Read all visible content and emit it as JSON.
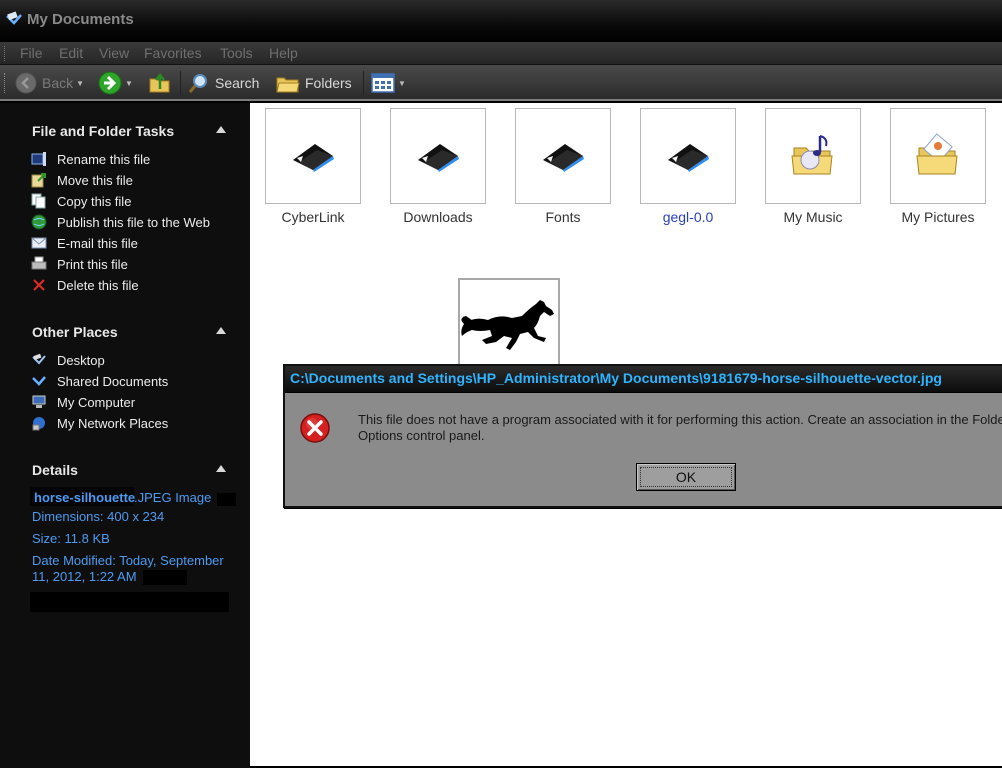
{
  "window": {
    "title": "My Documents",
    "icon": "my-documents-icon"
  },
  "menu": [
    "File",
    "Edit",
    "View",
    "Favorites",
    "Tools",
    "Help"
  ],
  "toolbar": {
    "back_label": "Back",
    "search_label": "Search",
    "folders_label": "Folders",
    "views_icon": "views-icon"
  },
  "sidebar": {
    "file_tasks": {
      "title": "File and Folder Tasks",
      "items": [
        {
          "label": "Rename this file",
          "icon": "rename-icon"
        },
        {
          "label": "Move this file",
          "icon": "move-icon"
        },
        {
          "label": "Copy this file",
          "icon": "copy-icon"
        },
        {
          "label": "Publish this file to the Web",
          "icon": "publish-web-icon"
        },
        {
          "label": "E-mail this file",
          "icon": "email-icon"
        },
        {
          "label": "Print this file",
          "icon": "print-icon"
        },
        {
          "label": "Delete this file",
          "icon": "delete-icon"
        }
      ]
    },
    "other_places": {
      "title": "Other Places",
      "items": [
        {
          "label": "Desktop",
          "icon": "desktop-icon"
        },
        {
          "label": "Shared Documents",
          "icon": "shared-documents-icon"
        },
        {
          "label": "My Computer",
          "icon": "my-computer-icon"
        },
        {
          "label": "My Network Places",
          "icon": "network-places-icon"
        }
      ]
    },
    "details": {
      "title": "Details",
      "name": "horse-silhouette",
      "type": "JPEG Image",
      "dimensions": "Dimensions: 400 x 234",
      "size": "Size: 11.8 KB",
      "modified_line1": "Date Modified: Today, September",
      "modified_line2": "11, 2012, 1:22 AM"
    }
  },
  "folders": [
    {
      "name": "CyberLink",
      "icon": "folder-icon"
    },
    {
      "name": "Downloads",
      "icon": "folder-icon"
    },
    {
      "name": "Fonts",
      "icon": "folder-icon"
    },
    {
      "name": "gegl-0.0",
      "icon": "folder-icon"
    },
    {
      "name": "My Music",
      "icon": "music-folder-icon"
    },
    {
      "name": "My Pictures",
      "icon": "pictures-folder-icon"
    }
  ],
  "dialog": {
    "title": "C:\\Documents and Settings\\HP_Administrator\\My Documents\\9181679-horse-silhouette-vector.jpg",
    "message_line1": "This file does not have a program associated with it for performing this action. Create an association in the Folder",
    "message_line2": "Options control panel.",
    "ok_label": "OK"
  }
}
